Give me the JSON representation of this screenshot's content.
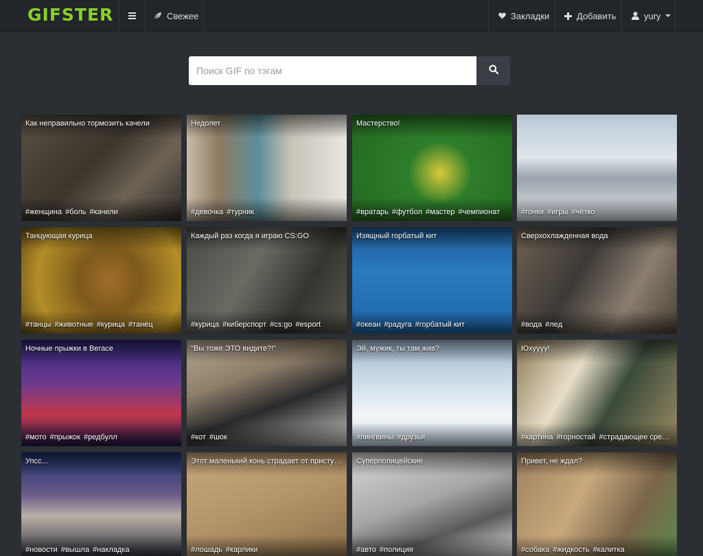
{
  "app": {
    "logo": "GIFSTER",
    "brand_color": "#8ad026"
  },
  "nav": {
    "menu_icon": "hamburger-icon",
    "fresh_label": "Свежее",
    "bookmarks_label": "Закладки",
    "add_label": "Добавить",
    "user_label": "yury"
  },
  "search": {
    "placeholder": "Поиск GIF по тэгам",
    "value": ""
  },
  "cards": [
    {
      "title": "Как неправильно тормозить качели",
      "tags": [
        "#женщина",
        "#боль",
        "#качели"
      ]
    },
    {
      "title": "Недолет",
      "tags": [
        "#девочка",
        "#турник"
      ]
    },
    {
      "title": "Мастерство!",
      "tags": [
        "#вратарь",
        "#футбол",
        "#мастер",
        "#чемпионат"
      ]
    },
    {
      "title": "",
      "tags": [
        "#гонки",
        "#игры",
        "#чётко"
      ]
    },
    {
      "title": "Танцующая курица",
      "tags": [
        "#танцы",
        "#животные",
        "#курица",
        "#танец"
      ]
    },
    {
      "title": "Каждый раз когда я играю CS:GO",
      "tags": [
        "#курица",
        "#киберспорт",
        "#cs:go",
        "#esport"
      ]
    },
    {
      "title": "Изящный горбатый кит",
      "tags": [
        "#океан",
        "#радуга",
        "#горбатый кит"
      ]
    },
    {
      "title": "Сверхохлажденная вода",
      "tags": [
        "#вода",
        "#лед"
      ]
    },
    {
      "title": "Ночные прыжки в Вегасе",
      "tags": [
        "#мото",
        "#прыжок",
        "#редбулл"
      ]
    },
    {
      "title": "\"Вы тоже ЭТО видите?!\"",
      "tags": [
        "#кот",
        "#шок"
      ]
    },
    {
      "title": "Эй, мужик, ты там жив?",
      "tags": [
        "#пингвины",
        "#друзья"
      ]
    },
    {
      "title": "Юхуууу!",
      "tags": [
        "#картина",
        "#горностай",
        "#страдающее средневековье"
      ]
    },
    {
      "title": "Упсс...",
      "tags": [
        "#новости",
        "#вышла",
        "#накладка"
      ]
    },
    {
      "title": "Этот маленький конь страдает от приступов нарколепсии",
      "tags": [
        "#лошадь",
        "#карлики"
      ]
    },
    {
      "title": "Суперполицейские",
      "tags": [
        "#авто",
        "#полиция"
      ]
    },
    {
      "title": "Привет, не ждал?",
      "tags": [
        "#собака",
        "#жидкость",
        "#калитка"
      ]
    }
  ]
}
